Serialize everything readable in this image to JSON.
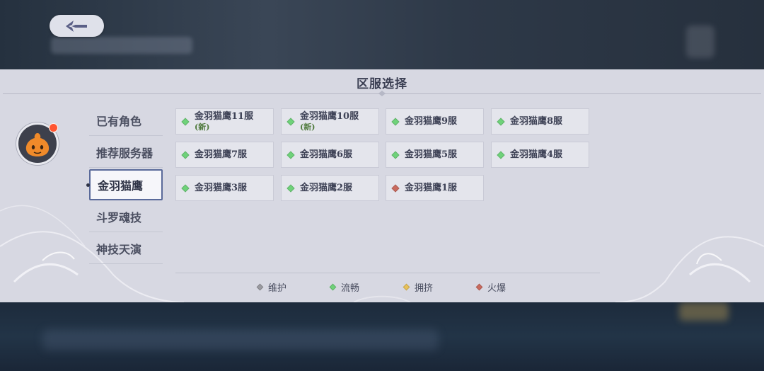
{
  "window": {
    "title": "区服选择"
  },
  "sidebar": {
    "items": [
      {
        "label": "已有角色",
        "active": false
      },
      {
        "label": "推荐服务器",
        "active": false
      },
      {
        "label": "金羽猫鹰",
        "active": true
      },
      {
        "label": "斗罗魂技",
        "active": false
      },
      {
        "label": "神技天演",
        "active": false
      }
    ]
  },
  "servers": [
    {
      "name": "金羽猫鹰11服",
      "tag": "(新)",
      "status": "流畅"
    },
    {
      "name": "金羽猫鹰10服",
      "tag": "(新)",
      "status": "流畅"
    },
    {
      "name": "金羽猫鹰9服",
      "tag": "",
      "status": "流畅"
    },
    {
      "name": "金羽猫鹰8服",
      "tag": "",
      "status": "流畅"
    },
    {
      "name": "金羽猫鹰7服",
      "tag": "",
      "status": "流畅"
    },
    {
      "name": "金羽猫鹰6服",
      "tag": "",
      "status": "流畅"
    },
    {
      "name": "金羽猫鹰5服",
      "tag": "",
      "status": "流畅"
    },
    {
      "name": "金羽猫鹰4服",
      "tag": "",
      "status": "流畅"
    },
    {
      "name": "金羽猫鹰3服",
      "tag": "",
      "status": "流畅"
    },
    {
      "name": "金羽猫鹰2服",
      "tag": "",
      "status": "流畅"
    },
    {
      "name": "金羽猫鹰1服",
      "tag": "",
      "status": "火爆"
    }
  ],
  "legend": [
    {
      "label": "维护",
      "color": "#9a9aa0"
    },
    {
      "label": "流畅",
      "color": "#6fd27a"
    },
    {
      "label": "拥挤",
      "color": "#e8c15a"
    },
    {
      "label": "火爆",
      "color": "#c96a5e"
    }
  ],
  "icons": {
    "back": "back-arrow-icon",
    "avatar": "orange-blob-avatar",
    "notification": "red-dot-badge"
  }
}
